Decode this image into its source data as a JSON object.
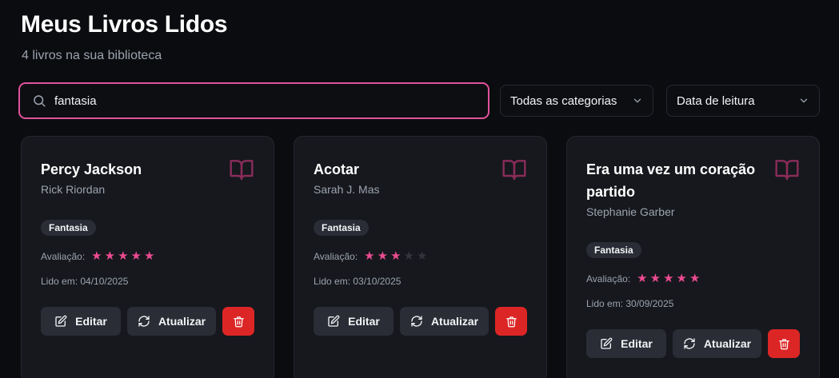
{
  "header": {
    "title": "Meus Livros Lidos",
    "subtitle": "4 livros na sua biblioteca"
  },
  "search": {
    "value": "fantasia",
    "icon": "search-icon"
  },
  "filters": {
    "category": {
      "selected": "Todas as categorias"
    },
    "sort": {
      "selected": "Data de leitura"
    }
  },
  "labels": {
    "rating": "Avaliação:",
    "read_prefix": "Lido em:",
    "edit": "Editar",
    "update": "Atualizar"
  },
  "colors": {
    "accent": "#ec4b91",
    "danger": "#dc2626",
    "background": "#0b0c0f",
    "card": "#16181d"
  },
  "books": [
    {
      "title": "Percy Jackson",
      "author": "Rick Riordan",
      "category": "Fantasia",
      "rating": 5,
      "rating_max": 5,
      "read_date": "Lido em: 04/10/2025"
    },
    {
      "title": "Acotar",
      "author": "Sarah J. Mas",
      "category": "Fantasia",
      "rating": 3,
      "rating_max": 5,
      "read_date": "Lido em: 03/10/2025"
    },
    {
      "title": "Era uma vez um coração partido",
      "author": "Stephanie Garber",
      "category": "Fantasia",
      "rating": 5,
      "rating_max": 5,
      "read_date": "Lido em: 30/09/2025"
    }
  ]
}
